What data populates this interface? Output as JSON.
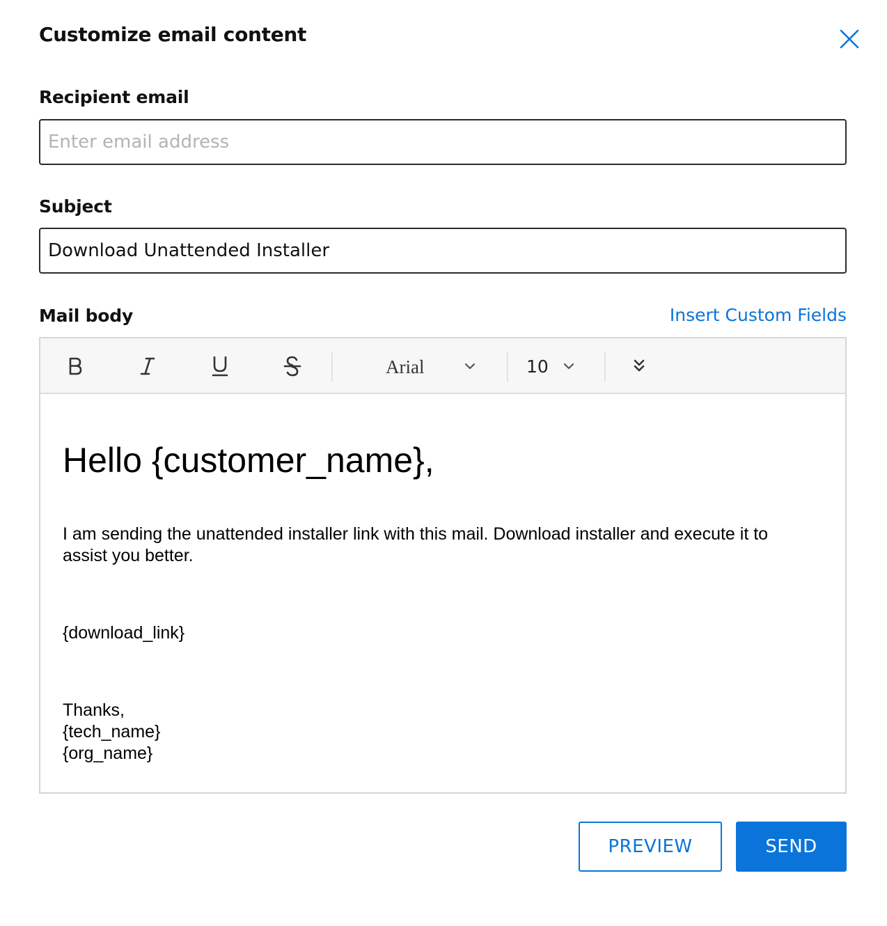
{
  "dialog": {
    "title": "Customize email content",
    "close_icon": "close-icon"
  },
  "recipient": {
    "label": "Recipient email",
    "value": "",
    "placeholder": "Enter email address"
  },
  "subject": {
    "label": "Subject",
    "value": "Download Unattended Installer"
  },
  "mail_body": {
    "label": "Mail body",
    "insert_custom_fields": "Insert Custom Fields",
    "toolbar": {
      "bold_icon": "bold-icon",
      "italic_icon": "italic-icon",
      "underline_icon": "underline-icon",
      "strikethrough_icon": "strikethrough-icon",
      "font_family": "Arial",
      "font_size": "10",
      "more_icon": "double-chevron-down-icon"
    },
    "content": {
      "greeting": "Hello {customer_name},",
      "paragraph": "I am sending the unattended installer link with this mail. Download installer and execute it to assist you better.",
      "download_link": "{download_link}",
      "closing": "Thanks,",
      "tech_name": "{tech_name}",
      "org_name": "{org_name}"
    }
  },
  "actions": {
    "preview_label": "PREVIEW",
    "send_label": "SEND"
  },
  "colors": {
    "accent": "#0a74da",
    "border": "#2b2b2b",
    "toolbar_bg": "#f7f7f7"
  }
}
